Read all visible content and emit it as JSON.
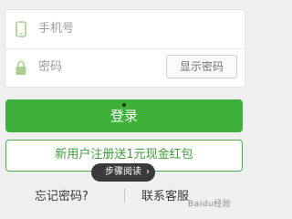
{
  "phone_field": {
    "placeholder": "手机号",
    "icon": "phone-icon"
  },
  "password_field": {
    "placeholder": "密码",
    "icon": "lock-icon"
  },
  "show_password_label": "显示密码",
  "login_label": "登录",
  "promo_label": "新用户注册送1元现金红包",
  "tooltip": {
    "label": "步骤阅读",
    "icon": "chevron-right-icon"
  },
  "links": {
    "forgot_password": "忘记密码?",
    "customer_service": "联系客服"
  },
  "watermark": "Baidu经验",
  "colors": {
    "accent_green": "#3eb13a",
    "page_bg": "#efefef"
  }
}
